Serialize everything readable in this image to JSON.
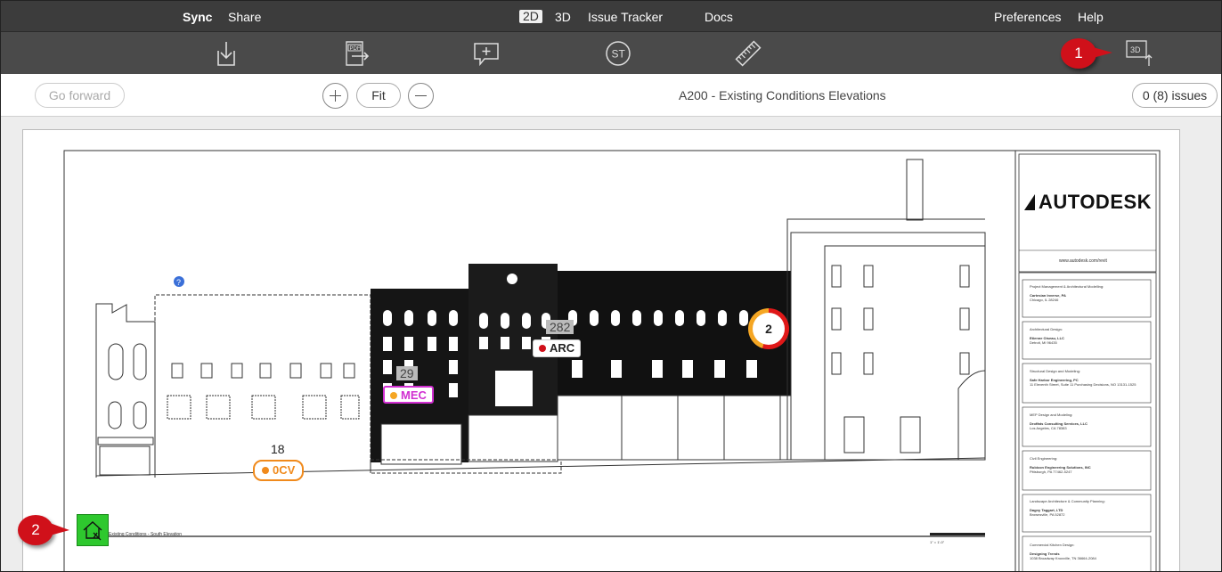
{
  "menubar": {
    "sync": "Sync",
    "share": "Share",
    "mode_2d": "2D",
    "mode_3d": "3D",
    "issue_tracker": "Issue Tracker",
    "docs": "Docs",
    "preferences": "Preferences",
    "help": "Help"
  },
  "toolbar": {
    "icons": [
      "download-icon",
      "pdf-export-icon",
      "add-comment-icon",
      "st-icon",
      "ruler-icon",
      "switch-3d-icon"
    ],
    "st_label": "ST",
    "pdf_label": "PDF",
    "switch3d_label": "3D"
  },
  "navbar": {
    "go_forward": "Go forward",
    "fit": "Fit",
    "title": "A200 - Existing Conditions Elevations",
    "issues": "0 (8) issues"
  },
  "callouts": {
    "one": "1",
    "two": "2"
  },
  "markers": {
    "arc": {
      "label": "ARC",
      "number": "282",
      "color": "#d0101a"
    },
    "mec": {
      "label": "MEC",
      "number": "29",
      "color": "#f5a623"
    },
    "cv": {
      "label": "0CV",
      "number": "18",
      "color": "#f08a1c"
    },
    "issue_count": "2"
  },
  "titleblock": {
    "logo": "AUTODESK",
    "url": "www.autodesk.com/revit",
    "entries": [
      {
        "role": "Project Management & Architectural Modelling:",
        "name": "Cartesian Inverse, PA",
        "addr": "Chicago, IL 28246"
      },
      {
        "role": "Architectural Design:",
        "name": "Etienne Oiseau, LLC",
        "addr": "Detroit, MI 96435"
      },
      {
        "role": "Structural Design and Modeling:",
        "name": "Safe Harbor Engineering, PC",
        "addr": "11 Eleventh Street, Suite 11 Purchasing Decisions, NO 13131-1525"
      },
      {
        "role": "MEP Design and Modeling:",
        "name": "Droffats Consulting Services, LLC",
        "addr": "Los Angeles, CA 78383"
      },
      {
        "role": "Civil Engineering:",
        "name": "Rubicon Engineering Solutions, INC",
        "addr": "Pittsburgh, PA 77462-5247"
      },
      {
        "role": "Landscape Architecture & Community Planning:",
        "name": "Dagny Taggart, LTD",
        "addr": "Brownsville, PA 52872"
      },
      {
        "role": "Commercial Kitchen Design:",
        "name": "Designing Trends",
        "addr": "1038 Broadway Knoxville, TN 36664-2084"
      }
    ]
  },
  "drawing": {
    "view_title": "Existing Conditions - South Elevation",
    "scale": "1\" = 1'-0\""
  }
}
